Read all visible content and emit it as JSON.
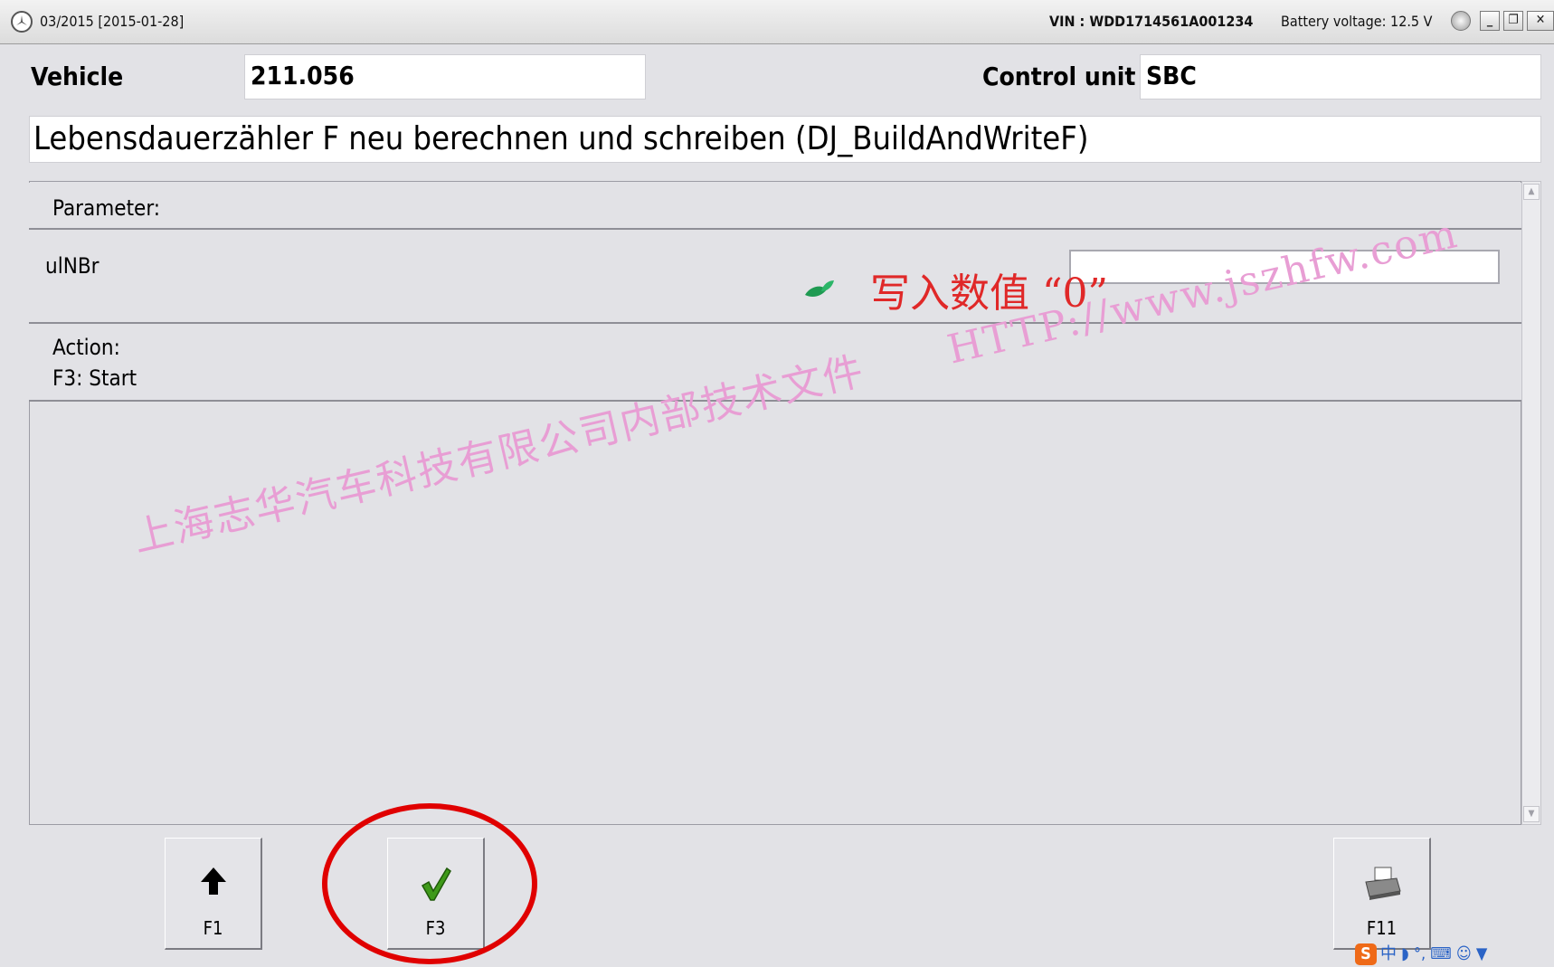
{
  "titlebar": {
    "date": "03/2015 [2015-01-28]",
    "vin": "VIN : WDD1714561A001234",
    "battery": "Battery voltage: 12.5 V",
    "minimize": "_",
    "restore": "❐",
    "close": "✕"
  },
  "header": {
    "vehicle_label": "Vehicle",
    "vehicle_value": "211.056",
    "control_unit_label": "Control unit",
    "control_unit_value": "SBC"
  },
  "function_title": "Lebensdauerzähler F neu berechnen und schreiben (DJ_BuildAndWriteF)",
  "parameter": {
    "heading": "Parameter:",
    "name": "ulNBr",
    "value": ""
  },
  "action": {
    "heading": "Action:",
    "text": "F3: Start"
  },
  "annotation": {
    "text": "写入数值",
    "quoted": "“0”"
  },
  "watermark": {
    "company": "上海志华汽车科技有限公司内部技术文件",
    "url": "HTTP://www.jszhfw.com"
  },
  "buttons": {
    "f1": "F1",
    "f3": "F3",
    "f11": "F11"
  },
  "ime": {
    "logo": "S",
    "lang": "中"
  },
  "icons": {
    "logo": "mercedes-star-icon",
    "battery": "battery-status-icon",
    "f1": "arrow-up-icon",
    "f3": "checkmark-icon",
    "f11": "printer-icon"
  }
}
